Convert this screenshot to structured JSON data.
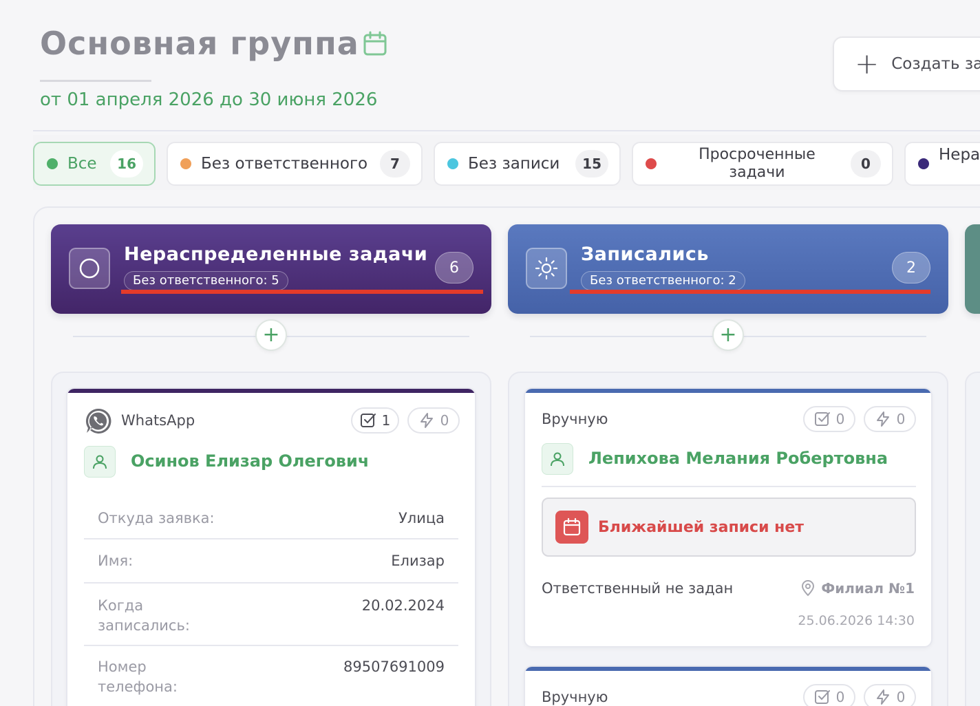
{
  "header": {
    "title": "Основная группа",
    "date_range": "от 01 апреля 2026 до 30 июня 2026",
    "create_label": "Создать за"
  },
  "filters": [
    {
      "label": "Все",
      "count": "16",
      "color": "#4fb06a",
      "active": true
    },
    {
      "label": "Без ответственного",
      "count": "7",
      "color": "#f0a05a"
    },
    {
      "label": "Без записи",
      "count": "15",
      "color": "#4cc6df"
    },
    {
      "label": "Просроченные задачи",
      "count": "0",
      "color": "#de4b4b"
    },
    {
      "label": "Нера",
      "color": "#3b2a7a"
    }
  ],
  "columns": [
    {
      "title": "Нераспределенные задачи",
      "subtitle": "Без ответственного: 5",
      "count": "6",
      "icon": "circle-icon",
      "color": "#4e3380"
    },
    {
      "title": "Записались",
      "subtitle": "Без ответственного: 2",
      "count": "2",
      "icon": "sun-icon",
      "color": "#506db3"
    }
  ],
  "cards": [
    {
      "source": "WhatsApp",
      "source_icon": "whatsapp-icon",
      "tasks": "1",
      "actions": "0",
      "name": "Осинов Елизар Олегович",
      "fields": [
        {
          "key": "Откуда заявка:",
          "value": "Улица"
        },
        {
          "key": "Имя:",
          "value": "Елизар"
        },
        {
          "key": "Когда записались:",
          "value": "20.02.2024"
        },
        {
          "key": "Номер телефона:",
          "value": "89507691009"
        }
      ]
    },
    {
      "source": "Вручную",
      "tasks": "0",
      "actions": "0",
      "name": "Лепихова Мелания Робертовна",
      "no_record": "Ближайшей записи нет",
      "responsible": "Ответственный не задан",
      "branch": "Филиал №1",
      "timestamp": "25.06.2026 14:30"
    },
    {
      "source": "Вручную",
      "tasks": "0",
      "actions": "0"
    }
  ]
}
